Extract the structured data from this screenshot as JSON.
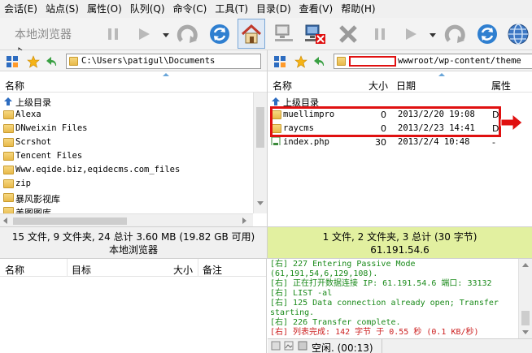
{
  "menu": [
    "会话(E)",
    "站点(S)",
    "属性(O)",
    "队列(Q)",
    "命令(C)",
    "工具(T)",
    "目录(D)",
    "查看(V)",
    "帮助(H)"
  ],
  "toolbar": {
    "local_title": "本地浏览器"
  },
  "local": {
    "path": "C:\\Users\\patigul\\Documents",
    "columns": {
      "name": "名称"
    },
    "rows": [
      {
        "name": "上级目录",
        "type": "up"
      },
      {
        "name": "Alexa",
        "type": "folder"
      },
      {
        "name": "DNweixin Files",
        "type": "folder"
      },
      {
        "name": "Scrshot",
        "type": "folder"
      },
      {
        "name": "Tencent Files",
        "type": "folder"
      },
      {
        "name": "Www.eqide.biz,eqidecms.com_files",
        "type": "folder"
      },
      {
        "name": "zip",
        "type": "folder"
      },
      {
        "name": "暴风影视库",
        "type": "folder"
      },
      {
        "name": "美图图库",
        "type": "folder"
      }
    ],
    "status": "15 文件, 9 文件夹, 24 总计 3.60 MB (19.82 GB 可用)",
    "label": "本地浏览器"
  },
  "remote": {
    "path": "wwwroot/wp-content/theme",
    "columns": {
      "name": "名称",
      "size": "大小",
      "date": "日期",
      "attr": "属性"
    },
    "rows": [
      {
        "name": "上级目录",
        "type": "up",
        "size": "",
        "date": "",
        "attr": ""
      },
      {
        "name": "muellimpro",
        "type": "folder",
        "size": "0",
        "date": "2013/2/20 19:08",
        "attr": "D"
      },
      {
        "name": "raycms",
        "type": "folder",
        "size": "0",
        "date": "2013/2/23 14:41",
        "attr": "D"
      },
      {
        "name": "index.php",
        "type": "file",
        "size": "30",
        "date": "2013/2/4 10:48",
        "attr": "-"
      }
    ],
    "status": "1 文件, 2 文件夹, 3 总计 (30 字节)",
    "host": "61.191.54.6"
  },
  "queue": {
    "columns": {
      "name": "名称",
      "target": "目标",
      "size": "大小",
      "note": "备注"
    }
  },
  "log": [
    {
      "text": "[右] 227 Entering Passive Mode",
      "color": "green"
    },
    {
      "text": "(61,191,54,6,129,108).",
      "color": "green"
    },
    {
      "text": "[右] 正在打开数据连接 IP: 61.191.54.6 端口: 33132",
      "color": "green"
    },
    {
      "text": "[右] LIST -al",
      "color": "green"
    },
    {
      "text": "[右] 125 Data connection already open; Transfer",
      "color": "green"
    },
    {
      "text": "starting.",
      "color": "green"
    },
    {
      "text": "[右] 226 Transfer complete.",
      "color": "green"
    },
    {
      "text": "[右] 列表完成: 142 字节 于 0.55 秒 (0.1 KB/秒)",
      "color": "red"
    }
  ],
  "bottom_status": "空闲. (00:13)",
  "colors": {
    "highlight": "#e01010",
    "remote_status_bg": "#e2f0a0",
    "log_green": "#1a8a1a",
    "log_red": "#cc1f1f"
  }
}
